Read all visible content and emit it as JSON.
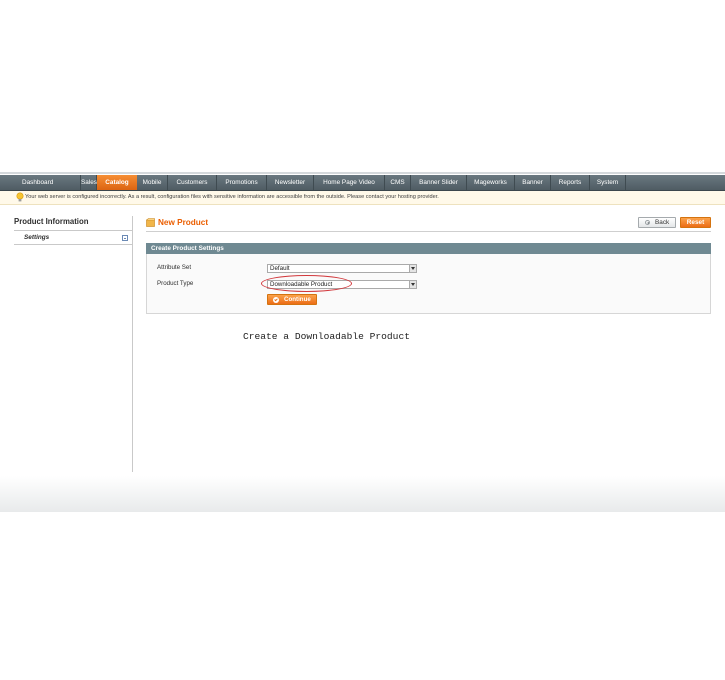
{
  "nav": {
    "items": [
      {
        "label": "Dashboard",
        "active": false
      },
      {
        "label": "Sales",
        "active": false
      },
      {
        "label": "Catalog",
        "active": true
      },
      {
        "label": "Mobile",
        "active": false
      },
      {
        "label": "Customers",
        "active": false
      },
      {
        "label": "Promotions",
        "active": false
      },
      {
        "label": "Newsletter",
        "active": false
      },
      {
        "label": "Home Page Video",
        "active": false
      },
      {
        "label": "CMS",
        "active": false
      },
      {
        "label": "Banner Slider",
        "active": false
      },
      {
        "label": "Mageworks",
        "active": false
      },
      {
        "label": "Banner",
        "active": false
      },
      {
        "label": "Reports",
        "active": false
      },
      {
        "label": "System",
        "active": false
      }
    ]
  },
  "notice": {
    "icon": "lightbulb-icon",
    "text": "Your web server is configured incorrectly. As a result, configuration files with sensitive information are accessible from the outside. Please contact your hosting provider."
  },
  "sidebar": {
    "title": "Product Information",
    "tab_label": "Settings",
    "tab_icon": "collapse-icon"
  },
  "page": {
    "title": "New Product",
    "title_icon": "product-box-icon",
    "back_label": "Back",
    "reset_label": "Reset"
  },
  "form": {
    "legend": "Create Product Settings",
    "attribute_set_label": "Attribute Set",
    "attribute_set_value": "Default",
    "product_type_label": "Product Type",
    "product_type_value": "Downloadable Product",
    "continue_label": "Continue"
  },
  "caption": "Create a Downloadable Product",
  "colors": {
    "accent_orange": "#eb5e00",
    "nav_bg": "#5b676e",
    "fieldset_header": "#6f8992",
    "annotation_red": "#d2383c"
  }
}
